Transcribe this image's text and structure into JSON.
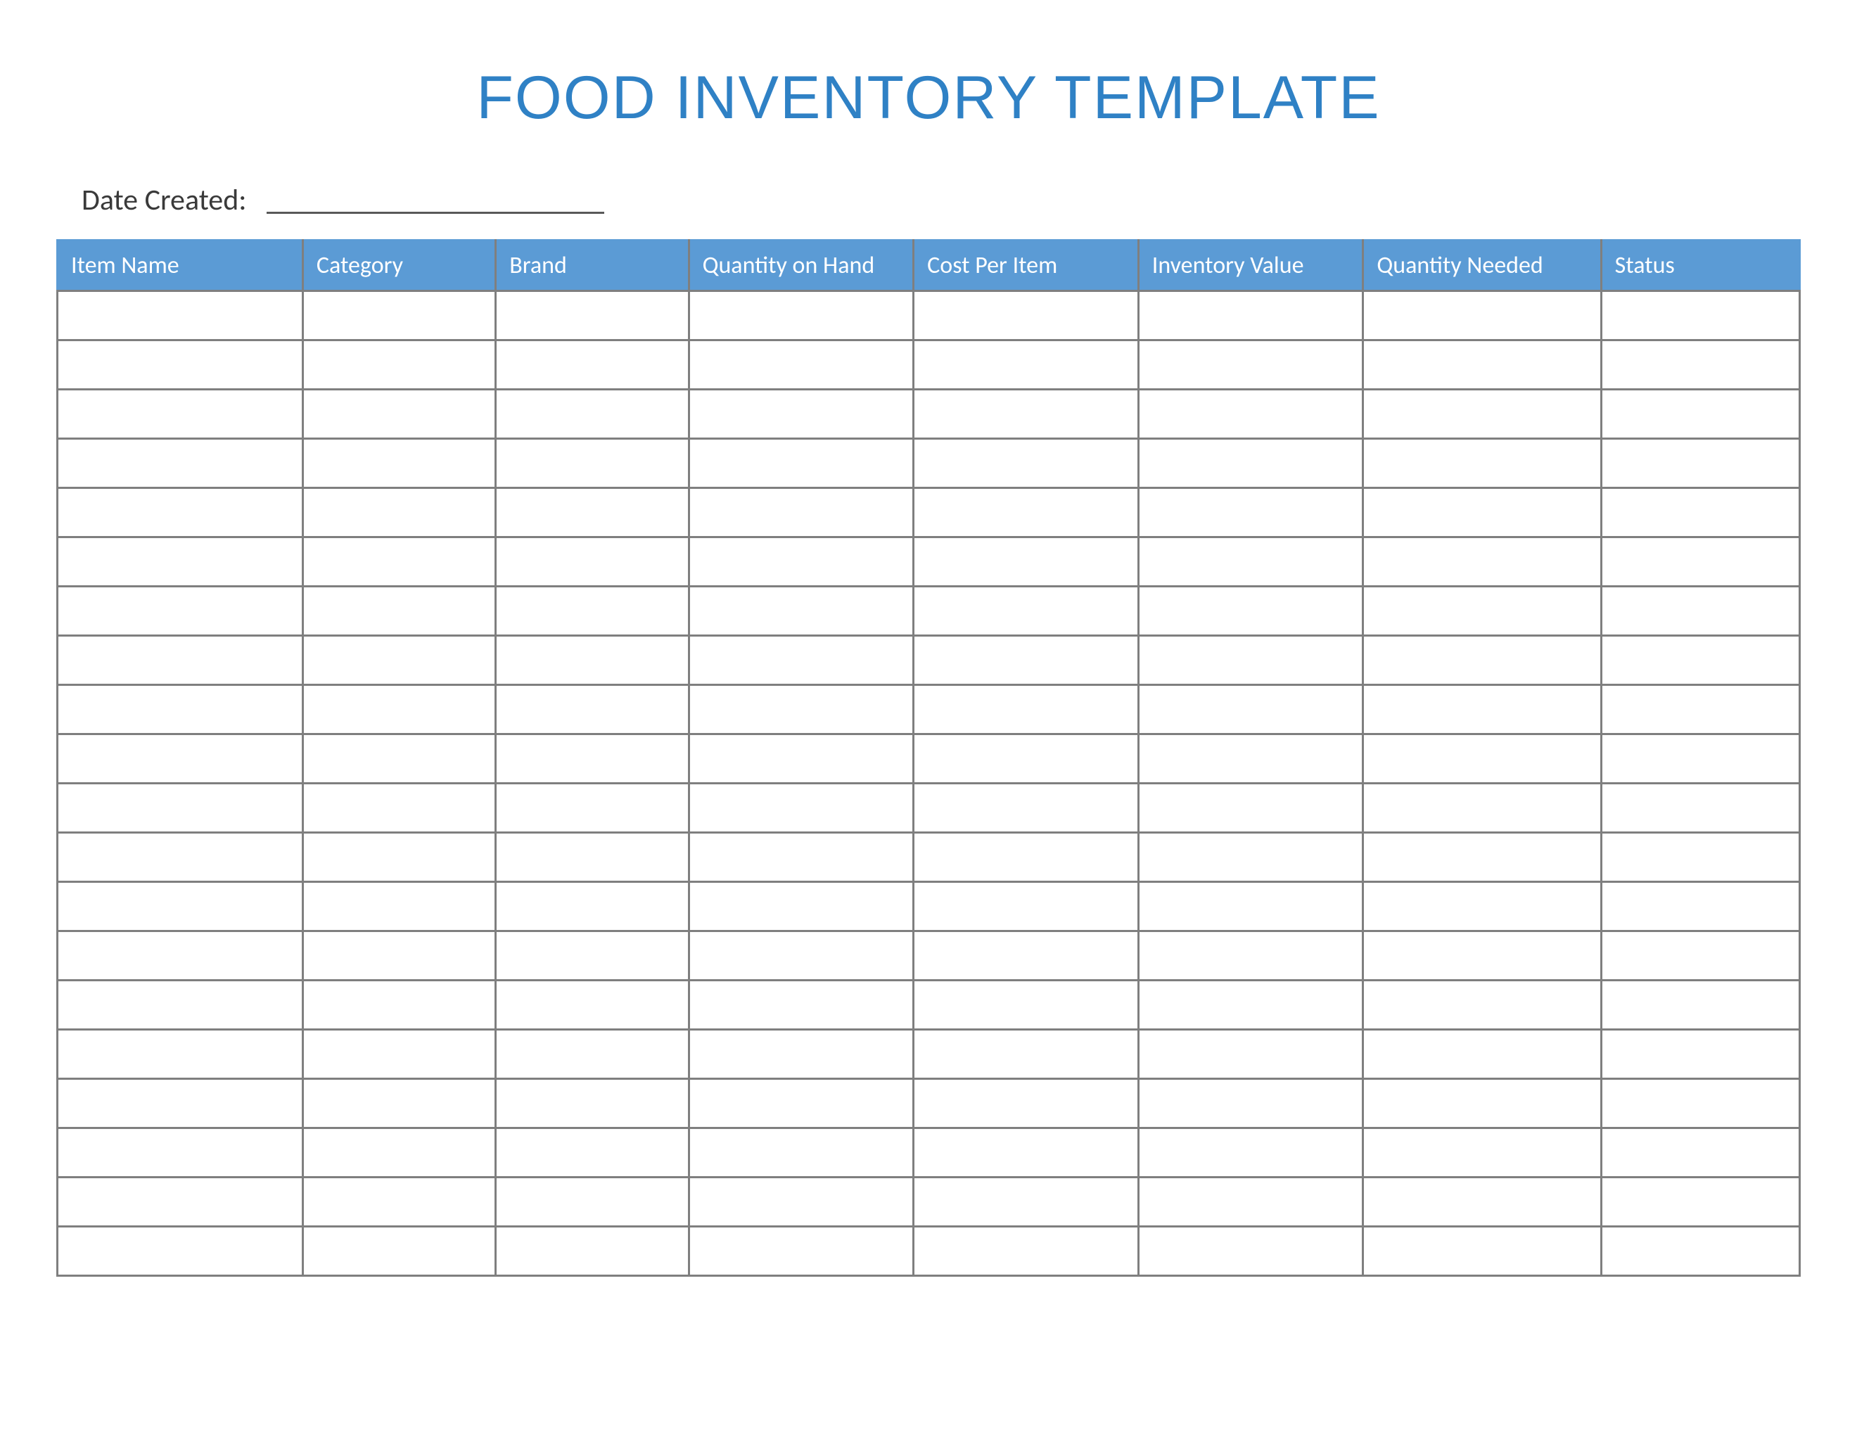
{
  "title": "FOOD INVENTORY TEMPLATE",
  "date_label": "Date Created:",
  "date_value": "",
  "columns": [
    "Item Name",
    "Category",
    "Brand",
    "Quantity on Hand",
    "Cost Per Item",
    "Inventory Value",
    "Quantity Needed",
    "Status"
  ],
  "column_widths_pct": [
    13.1,
    10.3,
    10.3,
    12.0,
    12.0,
    12.0,
    12.7,
    10.6
  ],
  "rows": [
    [
      "",
      "",
      "",
      "",
      "",
      "",
      "",
      ""
    ],
    [
      "",
      "",
      "",
      "",
      "",
      "",
      "",
      ""
    ],
    [
      "",
      "",
      "",
      "",
      "",
      "",
      "",
      ""
    ],
    [
      "",
      "",
      "",
      "",
      "",
      "",
      "",
      ""
    ],
    [
      "",
      "",
      "",
      "",
      "",
      "",
      "",
      ""
    ],
    [
      "",
      "",
      "",
      "",
      "",
      "",
      "",
      ""
    ],
    [
      "",
      "",
      "",
      "",
      "",
      "",
      "",
      ""
    ],
    [
      "",
      "",
      "",
      "",
      "",
      "",
      "",
      ""
    ],
    [
      "",
      "",
      "",
      "",
      "",
      "",
      "",
      ""
    ],
    [
      "",
      "",
      "",
      "",
      "",
      "",
      "",
      ""
    ],
    [
      "",
      "",
      "",
      "",
      "",
      "",
      "",
      ""
    ],
    [
      "",
      "",
      "",
      "",
      "",
      "",
      "",
      ""
    ],
    [
      "",
      "",
      "",
      "",
      "",
      "",
      "",
      ""
    ],
    [
      "",
      "",
      "",
      "",
      "",
      "",
      "",
      ""
    ],
    [
      "",
      "",
      "",
      "",
      "",
      "",
      "",
      ""
    ],
    [
      "",
      "",
      "",
      "",
      "",
      "",
      "",
      ""
    ],
    [
      "",
      "",
      "",
      "",
      "",
      "",
      "",
      ""
    ],
    [
      "",
      "",
      "",
      "",
      "",
      "",
      "",
      ""
    ],
    [
      "",
      "",
      "",
      "",
      "",
      "",
      "",
      ""
    ],
    [
      "",
      "",
      "",
      "",
      "",
      "",
      "",
      ""
    ]
  ]
}
